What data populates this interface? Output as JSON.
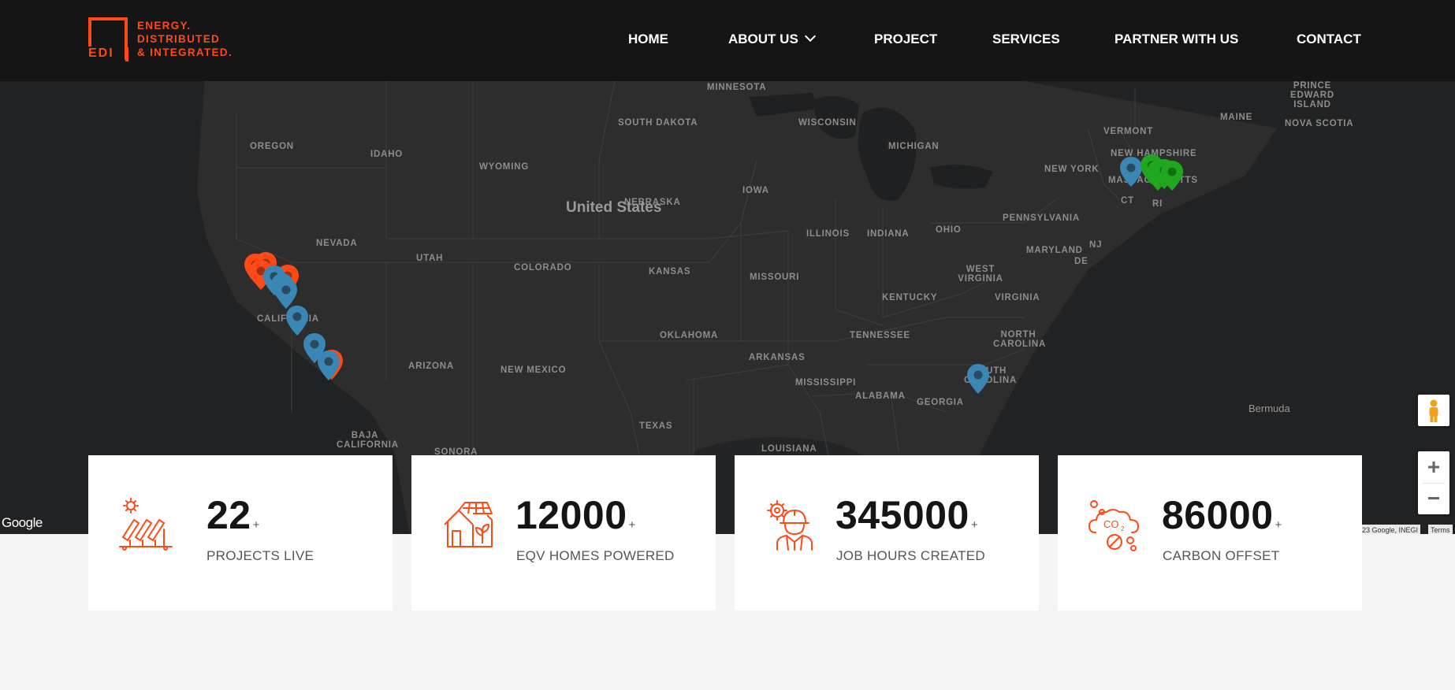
{
  "header": {
    "logo": {
      "mark": "EDI",
      "lines": [
        "ENERGY.",
        "DISTRIBUTED",
        "& INTEGRATED."
      ]
    },
    "nav": [
      {
        "label": "HOME"
      },
      {
        "label": "ABOUT US"
      },
      {
        "label": "PROJECT"
      },
      {
        "label": "SERVICES"
      },
      {
        "label": "PARTNER WITH US"
      },
      {
        "label": "CONTACT"
      }
    ]
  },
  "map": {
    "country": "United States",
    "states": [
      "MINNESOTA",
      "SOUTH DAKOTA",
      "WISCONSIN",
      "MICHIGAN",
      "VERMONT",
      "MAINE",
      "NOVA SCOTIA",
      "PRINCE EDWARD ISLAND",
      "OREGON",
      "IDAHO",
      "WYOMING",
      "NEW YORK",
      "NEW HAMPSHIRE",
      "MASSACHUSETTS",
      "CT",
      "RI",
      "NEBRASKA",
      "IOWA",
      "PENNSYLVANIA",
      "ILLINOIS",
      "INDIANA",
      "OHIO",
      "NJ",
      "NEVADA",
      "UTAH",
      "COLORADO",
      "KANSAS",
      "MARYLAND",
      "DE",
      "MISSOURI",
      "WEST VIRGINIA",
      "KENTUCKY",
      "VIRGINIA",
      "CALIFORNIA",
      "OKLAHOMA",
      "TENNESSEE",
      "NORTH CAROLINA",
      "ARIZONA",
      "NEW MEXICO",
      "ARKANSAS",
      "SOUTH CAROLINA",
      "MISSISSIPPI",
      "ALABAMA",
      "GEORGIA",
      "Bermuda",
      "TEXAS",
      "BAJA CALIFORNIA",
      "LOUISIANA",
      "SONORA"
    ],
    "brand": "Google",
    "attribution": "23 Google, INEGI",
    "terms": "Terms",
    "zoom_in": "+",
    "zoom_out": "−",
    "marker_colors": {
      "orange": "#ff4a17",
      "blue": "#3a86b5",
      "green": "#1fa81f"
    }
  },
  "stats": [
    {
      "value": "22",
      "suffix": "+",
      "label": "PROJECTS LIVE",
      "icon": "solar-panels-icon"
    },
    {
      "value": "12000",
      "suffix": "+",
      "label": "EQV HOMES POWERED",
      "icon": "solar-home-icon"
    },
    {
      "value": "345000",
      "suffix": "+",
      "label": "JOB HOURS CREATED",
      "icon": "engineer-worker-icon"
    },
    {
      "value": "86000",
      "suffix": "+",
      "label": "CARBON OFFSET",
      "icon": "co2-cloud-icon"
    }
  ],
  "colors": {
    "accent": "#ff4a17",
    "header_bg": "#151515",
    "map_bg": "#2d2d2e"
  }
}
